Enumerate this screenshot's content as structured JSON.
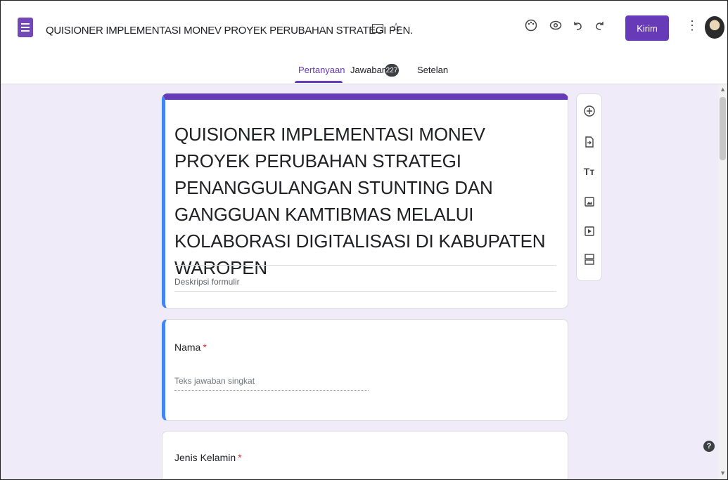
{
  "header": {
    "doc_title": "QUISIONER IMPLEMENTASI MONEV PROYEK PERUBAHAN STRATEGI PEN.",
    "send_label": "Kirim",
    "icons": [
      "forms-app-icon",
      "folder-icon",
      "star-icon",
      "palette-icon",
      "preview-eye-icon",
      "undo-icon",
      "redo-icon",
      "more-vert-icon",
      "avatar"
    ]
  },
  "tabs": [
    {
      "label": "Pertanyaan",
      "active": true
    },
    {
      "label": "Jawaban",
      "badge": "227"
    },
    {
      "label": "Setelan"
    }
  ],
  "form": {
    "title": "QUISIONER IMPLEMENTASI MONEV PROYEK PERUBAHAN STRATEGI PENANGGULANGAN STUNTING DAN GANGGUAN KAMTIBMAS MELALUI KOLABORASI DIGITALISASI DI KABUPATEN WAROPEN",
    "description_placeholder": "Deskripsi formulir",
    "questions": [
      {
        "label": "Nama",
        "required_mark": "*",
        "placeholder": "Teks jawaban singkat"
      },
      {
        "label": "Jenis Kelamin",
        "required_mark": "*"
      }
    ]
  },
  "side_toolbar": [
    "add-question-icon",
    "import-questions-icon",
    "add-title-icon",
    "add-image-icon",
    "add-video-icon",
    "add-section-icon"
  ],
  "help_label": "?",
  "colors": {
    "accent": "#673ab7",
    "focus": "#4285f4",
    "canvas": "#f0ebf8"
  }
}
